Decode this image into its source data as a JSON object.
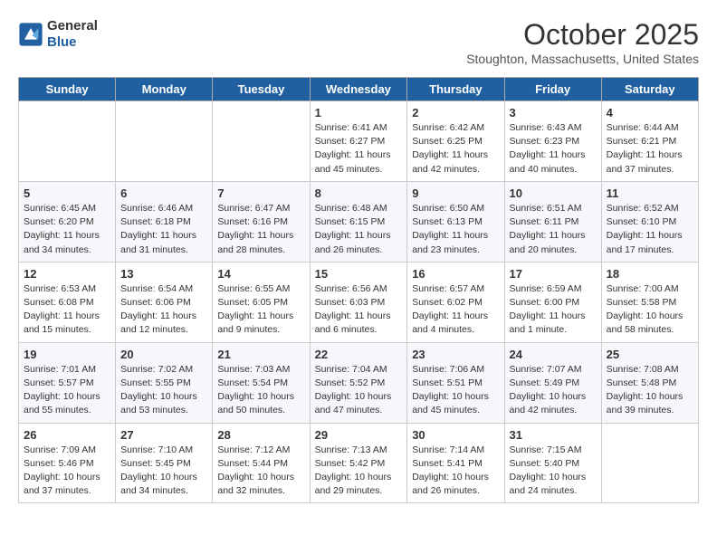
{
  "logo": {
    "general": "General",
    "blue": "Blue"
  },
  "header": {
    "month": "October 2025",
    "location": "Stoughton, Massachusetts, United States"
  },
  "weekdays": [
    "Sunday",
    "Monday",
    "Tuesday",
    "Wednesday",
    "Thursday",
    "Friday",
    "Saturday"
  ],
  "weeks": [
    [
      {
        "day": "",
        "info": ""
      },
      {
        "day": "",
        "info": ""
      },
      {
        "day": "",
        "info": ""
      },
      {
        "day": "1",
        "info": "Sunrise: 6:41 AM\nSunset: 6:27 PM\nDaylight: 11 hours\nand 45 minutes."
      },
      {
        "day": "2",
        "info": "Sunrise: 6:42 AM\nSunset: 6:25 PM\nDaylight: 11 hours\nand 42 minutes."
      },
      {
        "day": "3",
        "info": "Sunrise: 6:43 AM\nSunset: 6:23 PM\nDaylight: 11 hours\nand 40 minutes."
      },
      {
        "day": "4",
        "info": "Sunrise: 6:44 AM\nSunset: 6:21 PM\nDaylight: 11 hours\nand 37 minutes."
      }
    ],
    [
      {
        "day": "5",
        "info": "Sunrise: 6:45 AM\nSunset: 6:20 PM\nDaylight: 11 hours\nand 34 minutes."
      },
      {
        "day": "6",
        "info": "Sunrise: 6:46 AM\nSunset: 6:18 PM\nDaylight: 11 hours\nand 31 minutes."
      },
      {
        "day": "7",
        "info": "Sunrise: 6:47 AM\nSunset: 6:16 PM\nDaylight: 11 hours\nand 28 minutes."
      },
      {
        "day": "8",
        "info": "Sunrise: 6:48 AM\nSunset: 6:15 PM\nDaylight: 11 hours\nand 26 minutes."
      },
      {
        "day": "9",
        "info": "Sunrise: 6:50 AM\nSunset: 6:13 PM\nDaylight: 11 hours\nand 23 minutes."
      },
      {
        "day": "10",
        "info": "Sunrise: 6:51 AM\nSunset: 6:11 PM\nDaylight: 11 hours\nand 20 minutes."
      },
      {
        "day": "11",
        "info": "Sunrise: 6:52 AM\nSunset: 6:10 PM\nDaylight: 11 hours\nand 17 minutes."
      }
    ],
    [
      {
        "day": "12",
        "info": "Sunrise: 6:53 AM\nSunset: 6:08 PM\nDaylight: 11 hours\nand 15 minutes."
      },
      {
        "day": "13",
        "info": "Sunrise: 6:54 AM\nSunset: 6:06 PM\nDaylight: 11 hours\nand 12 minutes."
      },
      {
        "day": "14",
        "info": "Sunrise: 6:55 AM\nSunset: 6:05 PM\nDaylight: 11 hours\nand 9 minutes."
      },
      {
        "day": "15",
        "info": "Sunrise: 6:56 AM\nSunset: 6:03 PM\nDaylight: 11 hours\nand 6 minutes."
      },
      {
        "day": "16",
        "info": "Sunrise: 6:57 AM\nSunset: 6:02 PM\nDaylight: 11 hours\nand 4 minutes."
      },
      {
        "day": "17",
        "info": "Sunrise: 6:59 AM\nSunset: 6:00 PM\nDaylight: 11 hours\nand 1 minute."
      },
      {
        "day": "18",
        "info": "Sunrise: 7:00 AM\nSunset: 5:58 PM\nDaylight: 10 hours\nand 58 minutes."
      }
    ],
    [
      {
        "day": "19",
        "info": "Sunrise: 7:01 AM\nSunset: 5:57 PM\nDaylight: 10 hours\nand 55 minutes."
      },
      {
        "day": "20",
        "info": "Sunrise: 7:02 AM\nSunset: 5:55 PM\nDaylight: 10 hours\nand 53 minutes."
      },
      {
        "day": "21",
        "info": "Sunrise: 7:03 AM\nSunset: 5:54 PM\nDaylight: 10 hours\nand 50 minutes."
      },
      {
        "day": "22",
        "info": "Sunrise: 7:04 AM\nSunset: 5:52 PM\nDaylight: 10 hours\nand 47 minutes."
      },
      {
        "day": "23",
        "info": "Sunrise: 7:06 AM\nSunset: 5:51 PM\nDaylight: 10 hours\nand 45 minutes."
      },
      {
        "day": "24",
        "info": "Sunrise: 7:07 AM\nSunset: 5:49 PM\nDaylight: 10 hours\nand 42 minutes."
      },
      {
        "day": "25",
        "info": "Sunrise: 7:08 AM\nSunset: 5:48 PM\nDaylight: 10 hours\nand 39 minutes."
      }
    ],
    [
      {
        "day": "26",
        "info": "Sunrise: 7:09 AM\nSunset: 5:46 PM\nDaylight: 10 hours\nand 37 minutes."
      },
      {
        "day": "27",
        "info": "Sunrise: 7:10 AM\nSunset: 5:45 PM\nDaylight: 10 hours\nand 34 minutes."
      },
      {
        "day": "28",
        "info": "Sunrise: 7:12 AM\nSunset: 5:44 PM\nDaylight: 10 hours\nand 32 minutes."
      },
      {
        "day": "29",
        "info": "Sunrise: 7:13 AM\nSunset: 5:42 PM\nDaylight: 10 hours\nand 29 minutes."
      },
      {
        "day": "30",
        "info": "Sunrise: 7:14 AM\nSunset: 5:41 PM\nDaylight: 10 hours\nand 26 minutes."
      },
      {
        "day": "31",
        "info": "Sunrise: 7:15 AM\nSunset: 5:40 PM\nDaylight: 10 hours\nand 24 minutes."
      },
      {
        "day": "",
        "info": ""
      }
    ]
  ]
}
